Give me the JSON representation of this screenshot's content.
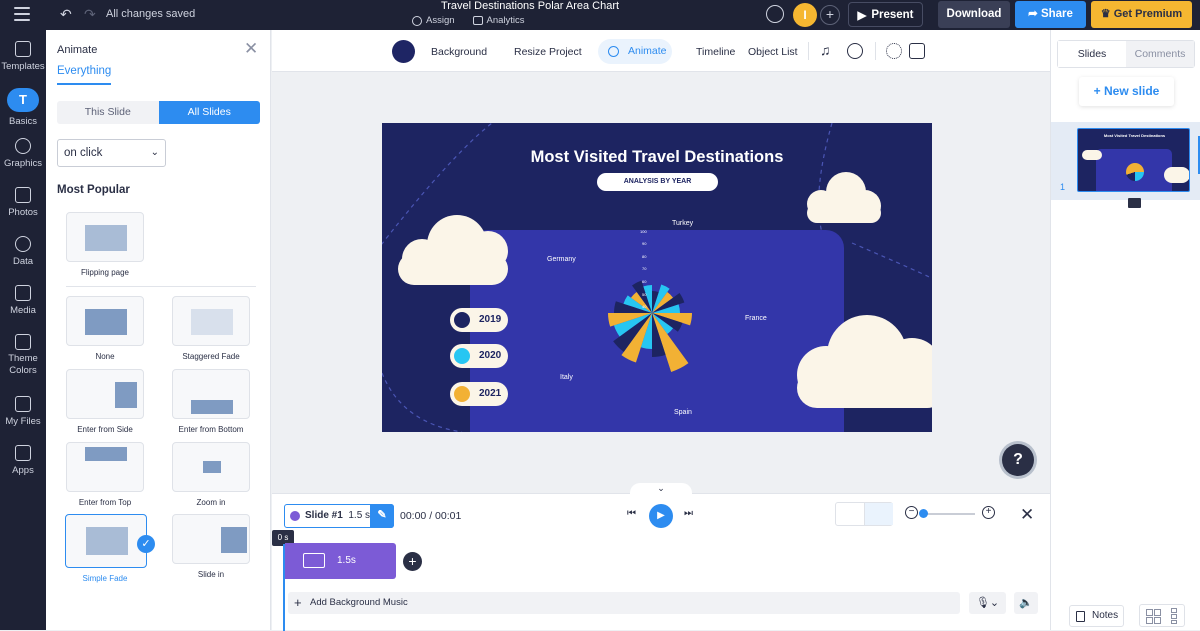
{
  "header": {
    "saved_status": "All changes saved",
    "doc_title": "Travel Destinations Polar Area Chart",
    "assign": "Assign",
    "analytics": "Analytics",
    "user_initial": "I",
    "present": "Present",
    "download": "Download",
    "share": "Share",
    "get_premium": "Get Premium"
  },
  "rail": {
    "items": [
      {
        "label": "Templates",
        "icon": "templates-icon"
      },
      {
        "label": "Basics",
        "icon": "basics-icon",
        "glyph": "T"
      },
      {
        "label": "Graphics",
        "icon": "graphics-icon"
      },
      {
        "label": "Photos",
        "icon": "photos-icon"
      },
      {
        "label": "Data",
        "icon": "data-icon"
      },
      {
        "label": "Media",
        "icon": "media-icon"
      },
      {
        "label": "Theme Colors",
        "icon": "theme-colors-icon"
      },
      {
        "label": "My Files",
        "icon": "my-files-icon"
      },
      {
        "label": "Apps",
        "icon": "apps-icon"
      }
    ]
  },
  "animate_panel": {
    "title": "Animate",
    "tab": "Everything",
    "this_slide": "This Slide",
    "all_slides": "All Slides",
    "trigger": "on click",
    "section": "Most Popular",
    "effects": [
      "Flipping page",
      "None",
      "Staggered Fade",
      "Enter from Side",
      "Enter from Bottom",
      "Enter from Top",
      "Zoom in",
      "Simple Fade",
      "Slide in"
    ],
    "selected": "Simple Fade"
  },
  "toolbar": {
    "background": "Background",
    "resize": "Resize Project",
    "animate": "Animate",
    "timeline": "Timeline",
    "object_list": "Object List",
    "swatch_color": "#1e2564"
  },
  "slide": {
    "title": "Most Visited Travel Destinations",
    "subtitle": "ANALYSIS BY YEAR",
    "labels": {
      "turkey": "Turkey",
      "germany": "Germany",
      "france": "France",
      "italy": "Italy",
      "spain": "Spain"
    },
    "scale_ticks": [
      "100",
      "90",
      "80",
      "70",
      "60",
      "50",
      "40"
    ],
    "legend": [
      {
        "year": "2019",
        "color": "#1d2461"
      },
      {
        "year": "2020",
        "color": "#27c6f2"
      },
      {
        "year": "2021",
        "color": "#f2b134"
      }
    ]
  },
  "timeline": {
    "slide_chip": "Slide #1",
    "slide_duration": "1.5 s",
    "time": "00:00 / 00:01",
    "start_marker": "0 s",
    "block_duration": "1.5s",
    "bg_music": "Add Background Music"
  },
  "right_panel": {
    "tab_slides": "Slides",
    "tab_comments": "Comments",
    "new_slide": "+ New slide",
    "slide_number": "1",
    "notes": "Notes"
  },
  "help": "?"
}
